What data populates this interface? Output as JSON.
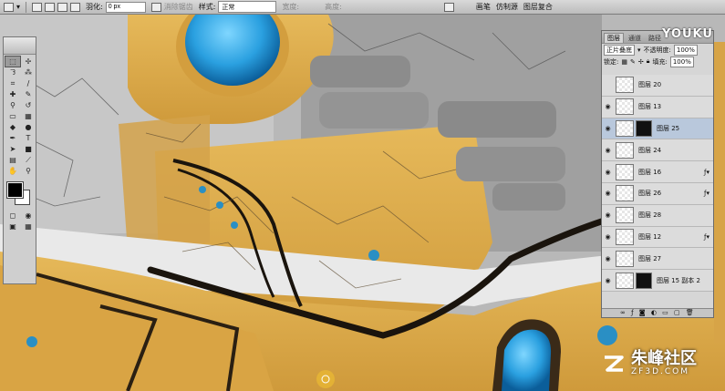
{
  "options_bar": {
    "feather_label": "羽化:",
    "feather_value": "0 px",
    "antialias_label": "消除锯齿",
    "style_label": "样式:",
    "style_value": "正常",
    "width_label": "宽度:",
    "height_label": "高度:",
    "panel_tabs": [
      "画笔",
      "仿制源",
      "图层复合"
    ]
  },
  "layers_panel": {
    "tabs": [
      "图层",
      "通道",
      "路径"
    ],
    "blend_mode": "正片叠底",
    "opacity_label": "不透明度:",
    "opacity_value": "100%",
    "lock_label": "锁定:",
    "fill_label": "填充:",
    "fill_value": "100%",
    "layers": [
      {
        "name": "图层 20",
        "visible": false,
        "linked_mask": false,
        "fx": false,
        "active": false
      },
      {
        "name": "图层 13",
        "visible": true,
        "linked_mask": false,
        "fx": false,
        "active": false
      },
      {
        "name": "图层 25",
        "visible": true,
        "linked_mask": true,
        "fx": false,
        "active": true
      },
      {
        "name": "图层 24",
        "visible": true,
        "linked_mask": false,
        "fx": false,
        "active": false
      },
      {
        "name": "图层 16",
        "visible": true,
        "linked_mask": false,
        "fx": true,
        "active": false
      },
      {
        "name": "图层 26",
        "visible": true,
        "linked_mask": false,
        "fx": true,
        "active": false
      },
      {
        "name": "图层 28",
        "visible": true,
        "linked_mask": false,
        "fx": false,
        "active": false
      },
      {
        "name": "图层 12",
        "visible": true,
        "linked_mask": false,
        "fx": true,
        "active": false
      },
      {
        "name": "图层 27",
        "visible": true,
        "linked_mask": false,
        "fx": false,
        "active": false
      },
      {
        "name": "图层 15 副本 2",
        "visible": true,
        "linked_mask": true,
        "fx": false,
        "active": false
      }
    ]
  },
  "watermarks": {
    "youku": "YOUKU",
    "zf3d_cn": "朱峰社区",
    "zf3d_en": "ZF3D.COM"
  },
  "colors": {
    "foreground": "#000000",
    "background": "#ffffff",
    "canvas_yellow": "#d9a94a",
    "canvas_grey": "#a9a9a9",
    "canvas_blue": "#2ea9e6"
  }
}
